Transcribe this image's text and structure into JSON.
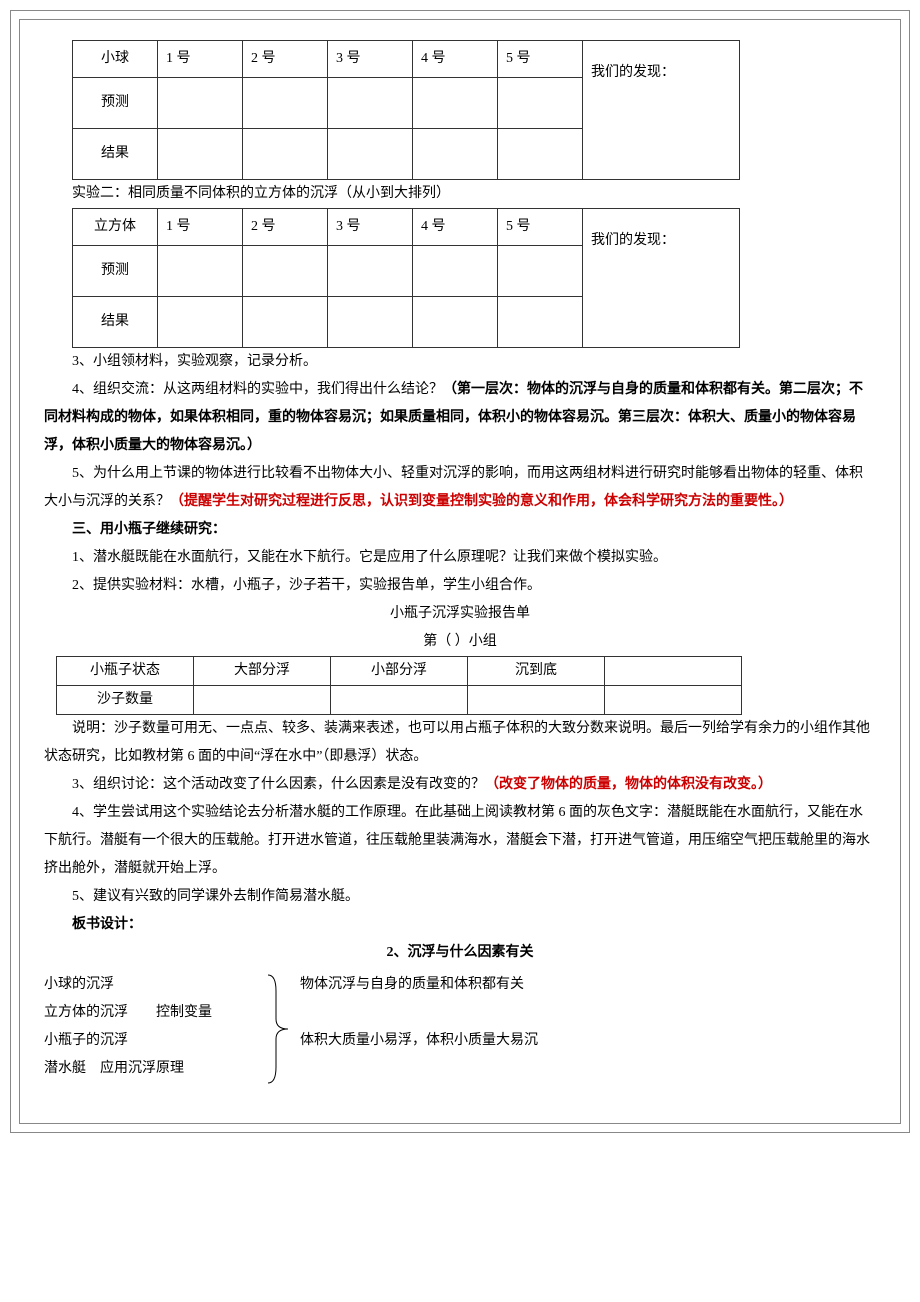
{
  "table1": {
    "row1_label": "小球",
    "cols": [
      "1 号",
      "2 号",
      "3 号",
      "4 号",
      "5 号"
    ],
    "row2_label": "预测",
    "row3_label": "结果",
    "discover": "我们的发现："
  },
  "exp2_intro": "实验二：相同质量不同体积的立方体的沉浮（从小到大排列）",
  "table2": {
    "row1_label": "立方体",
    "cols": [
      "1 号",
      "2 号",
      "3 号",
      "4 号",
      "5 号"
    ],
    "row2_label": "预测",
    "row3_label": "结果",
    "discover": "我们的发现："
  },
  "p3": "3、小组领材料，实验观察，记录分析。",
  "p4a": "4、组织交流：从这两组材料的实验中，我们得出什么结论？",
  "p4b": "（第一层次：物体的沉浮与自身的质量和体积都有关。第二层次；不同材料构成的物体，如果体积相同，重的物体容易沉；如果质量相同，体积小的物体容易沉。第三层次：体积大、质量小的物体容易浮，体积小质量大的物体容易沉。）",
  "p5a": "5、为什么用上节课的物体进行比较看不出物体大小、轻重对沉浮的影响，而用这两组材料进行研究时能够看出物体的轻重、体积大小与沉浮的关系？",
  "p5b": "（提醒学生对研究过程进行反思，认识到变量控制实验的意义和作用，体会科学研究方法的重要性。）",
  "sec3_title": "三、用小瓶子继续研究：",
  "sec3_p1": "1、潜水艇既能在水面航行，又能在水下航行。它是应用了什么原理呢？让我们来做个模拟实验。",
  "sec3_p2": "2、提供实验材料：水槽，小瓶子，沙子若干，实验报告单，学生小组合作。",
  "report_title": "小瓶子沉浮实验报告单",
  "group_line": "第（    ）小组",
  "state_table": {
    "row1": [
      "小瓶子状态",
      "大部分浮",
      "小部分浮",
      "沉到底",
      ""
    ],
    "row2_label": "沙子数量"
  },
  "note1": "说明：沙子数量可用无、一点点、较多、装满来表述，也可以用占瓶子体积的大致分数来说明。最后一列给学有余力的小组作其他状态研究，比如教材第 6 面的中间“浮在水中”（即悬浮）状态。",
  "p_disc3a": "3、组织讨论：这个活动改变了什么因素，什么因素是没有改变的？",
  "p_disc3b": "（改变了物体的质量，物体的体积没有改变。）",
  "p_disc4": "4、学生尝试用这个实验结论去分析潜水艇的工作原理。在此基础上阅读教材第 6 面的灰色文字：潜艇既能在水面航行，又能在水下航行。潜艇有一个很大的压载舱。打开进水管道，往压载舱里装满海水，潜艇会下潜，打开进气管道，用压缩空气把压载舱里的海水挤出舱外，潜艇就开始上浮。",
  "p_disc5": "5、建议有兴致的同学课外去制作简易潜水艇。",
  "board_label": "板书设计：",
  "board_title": "2、沉浮与什么因素有关",
  "board_left": [
    "小球的沉浮",
    "立方体的沉浮",
    "小瓶子的沉浮",
    "潜水艇　应用沉浮原理"
  ],
  "board_control": "控制变量",
  "board_right1": "物体沉浮与自身的质量和体积都有关",
  "board_right2": "体积大质量小易浮，体积小质量大易沉"
}
